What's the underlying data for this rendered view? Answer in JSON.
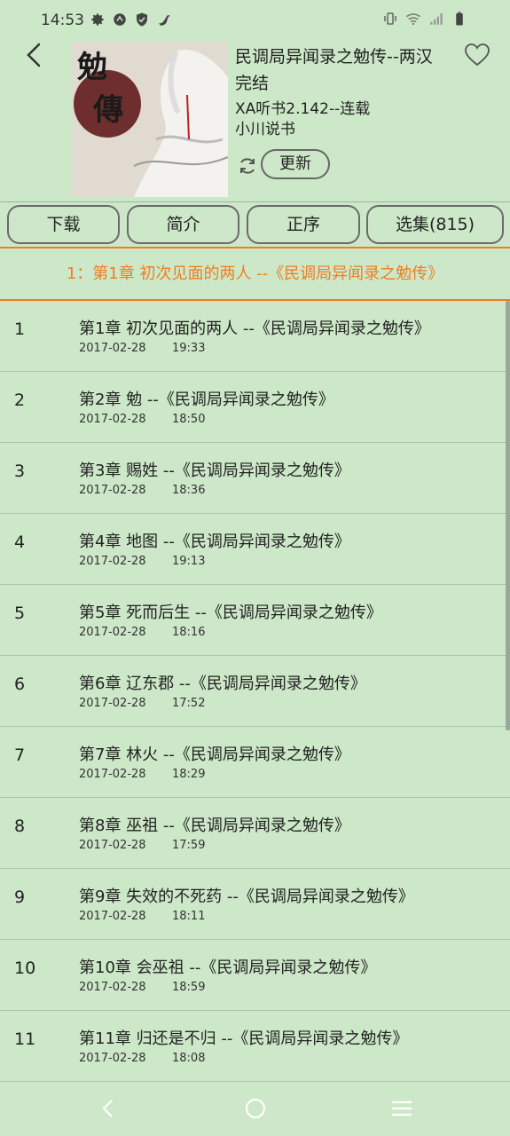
{
  "status": {
    "time": "14:53",
    "left_icons": [
      "settings-icon",
      "sync-icon",
      "shield-icon",
      "bird-icon"
    ],
    "right_icons": [
      "vibrate-icon",
      "wifi-icon",
      "signal-icon",
      "battery-icon"
    ]
  },
  "header": {
    "title": "民调局异闻录之勉传--两汉完结",
    "source": "XA听书2.142--连载",
    "author": "小川说书",
    "update_label": "更新"
  },
  "tabs": {
    "download": "下载",
    "intro": "简介",
    "order": "正序",
    "episodes": "选集(815)"
  },
  "current_chapter": "1：第1章 初次见面的两人 --《民调局异闻录之勉传》",
  "chapters": [
    {
      "num": "1",
      "title": "第1章 初次见面的两人 --《民调局异闻录之勉传》",
      "date": "2017-02-28",
      "time": "19:33"
    },
    {
      "num": "2",
      "title": "第2章 勉 --《民调局异闻录之勉传》",
      "date": "2017-02-28",
      "time": "18:50"
    },
    {
      "num": "3",
      "title": "第3章 赐姓 --《民调局异闻录之勉传》",
      "date": "2017-02-28",
      "time": "18:36"
    },
    {
      "num": "4",
      "title": "第4章 地图 --《民调局异闻录之勉传》",
      "date": "2017-02-28",
      "time": "19:13"
    },
    {
      "num": "5",
      "title": "第5章 死而后生 --《民调局异闻录之勉传》",
      "date": "2017-02-28",
      "time": "18:16"
    },
    {
      "num": "6",
      "title": "第6章 辽东郡 --《民调局异闻录之勉传》",
      "date": "2017-02-28",
      "time": "17:52"
    },
    {
      "num": "7",
      "title": "第7章 林火 --《民调局异闻录之勉传》",
      "date": "2017-02-28",
      "time": "18:29"
    },
    {
      "num": "8",
      "title": "第8章 巫祖 --《民调局异闻录之勉传》",
      "date": "2017-02-28",
      "time": "17:59"
    },
    {
      "num": "9",
      "title": "第9章 失效的不死药 --《民调局异闻录之勉传》",
      "date": "2017-02-28",
      "time": "18:11"
    },
    {
      "num": "10",
      "title": "第10章 会巫祖 --《民调局异闻录之勉传》",
      "date": "2017-02-28",
      "time": "18:59"
    },
    {
      "num": "11",
      "title": "第11章 归还是不归 --《民调局异闻录之勉传》",
      "date": "2017-02-28",
      "time": "18:08"
    }
  ],
  "colors": {
    "background": "#cde8c8",
    "accent": "#ef7d21"
  },
  "nav": [
    "back-nav-icon",
    "home-nav-icon",
    "menu-nav-icon"
  ]
}
